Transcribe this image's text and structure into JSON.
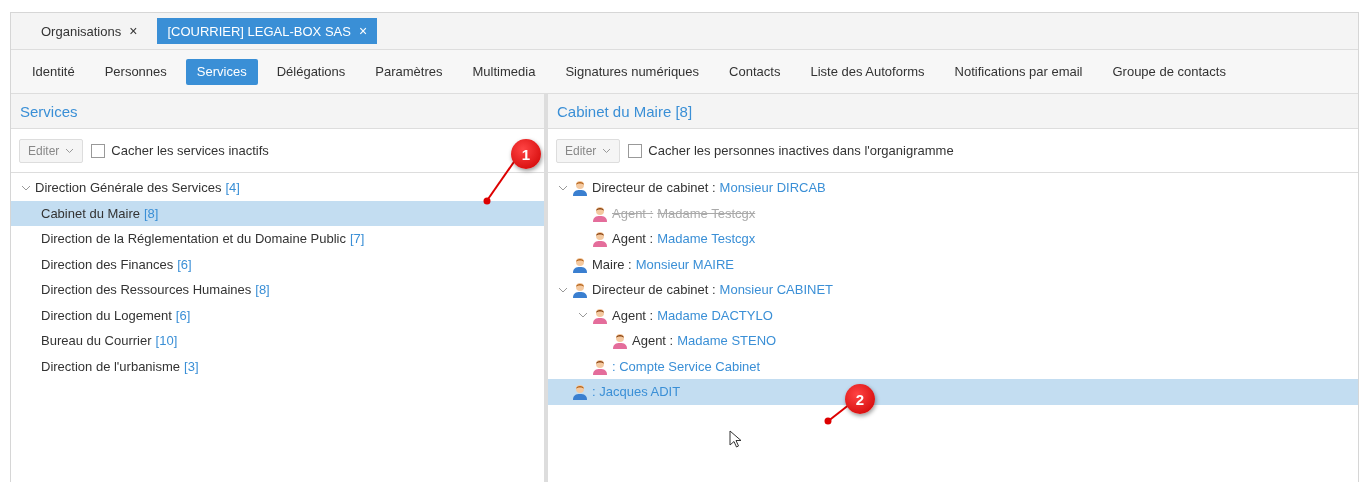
{
  "tabs": [
    {
      "label": "Organisations",
      "close": "×",
      "selected": false
    },
    {
      "label": "[COURRIER] LEGAL-BOX SAS",
      "close": "×",
      "selected": true
    }
  ],
  "subtabs": [
    {
      "label": "Identité",
      "selected": false
    },
    {
      "label": "Personnes",
      "selected": false
    },
    {
      "label": "Services",
      "selected": true
    },
    {
      "label": "Délégations",
      "selected": false
    },
    {
      "label": "Paramètres",
      "selected": false
    },
    {
      "label": "Multimedia",
      "selected": false
    },
    {
      "label": "Signatures numériques",
      "selected": false
    },
    {
      "label": "Contacts",
      "selected": false
    },
    {
      "label": "Liste des Autoforms",
      "selected": false
    },
    {
      "label": "Notifications par email",
      "selected": false
    },
    {
      "label": "Groupe de contacts",
      "selected": false
    }
  ],
  "left_panel": {
    "title": "Services",
    "edit_button": "Editer",
    "checkbox": {
      "label": "Cacher les services inactifs",
      "checked": false
    },
    "tree": [
      {
        "label": "Direction Générale des Services",
        "count": "[4]",
        "expanded": true,
        "selected": false,
        "children": [
          {
            "label": "Cabinet du Maire",
            "count": "[8]",
            "selected": true
          },
          {
            "label": "Direction de la Réglementation et du Domaine Public",
            "count": "[7]",
            "selected": false
          },
          {
            "label": "Direction des Finances",
            "count": "[6]",
            "selected": false
          },
          {
            "label": "Direction des Ressources Humaines",
            "count": "[8]",
            "selected": false
          },
          {
            "label": "Direction du Logement",
            "count": "[6]",
            "selected": false
          },
          {
            "label": "Bureau du Courrier",
            "count": "[10]",
            "selected": false
          },
          {
            "label": "Direction de l'urbanisme",
            "count": "[3]",
            "selected": false
          }
        ]
      }
    ]
  },
  "right_panel": {
    "title": "Cabinet du Maire [8]",
    "edit_button": "Editer",
    "checkbox": {
      "label": "Cacher les personnes inactives dans l'organigramme",
      "checked": false
    },
    "tree": [
      {
        "kind": "male",
        "role": "Directeur de cabinet :",
        "name": "Monsieur DIRCAB",
        "inactive": false,
        "selected": false,
        "expanded": true,
        "children": [
          {
            "kind": "female",
            "role": "Agent :",
            "name": "Madame Testcgx",
            "inactive": true,
            "selected": false
          },
          {
            "kind": "female",
            "role": "Agent :",
            "name": "Madame Testcgx",
            "inactive": false,
            "selected": false
          }
        ]
      },
      {
        "kind": "male",
        "role": "Maire :",
        "name": "Monsieur MAIRE",
        "inactive": false,
        "selected": false
      },
      {
        "kind": "male",
        "role": "Directeur de cabinet :",
        "name": "Monsieur CABINET",
        "inactive": false,
        "selected": false,
        "expanded": true,
        "children": [
          {
            "kind": "female",
            "role": "Agent :",
            "name": "Madame DACTYLO",
            "inactive": false,
            "selected": false,
            "expanded": true,
            "children": [
              {
                "kind": "female",
                "role": "Agent :",
                "name": "Madame STENO",
                "inactive": false,
                "selected": false
              }
            ]
          },
          {
            "kind": "female",
            "name": ": Compte Service Cabinet",
            "inactive": false,
            "selected": false
          }
        ]
      },
      {
        "kind": "male",
        "name": ": Jacques ADIT",
        "inactive": false,
        "selected": true
      }
    ]
  },
  "annotations": [
    {
      "label": "1"
    },
    {
      "label": "2"
    }
  ]
}
